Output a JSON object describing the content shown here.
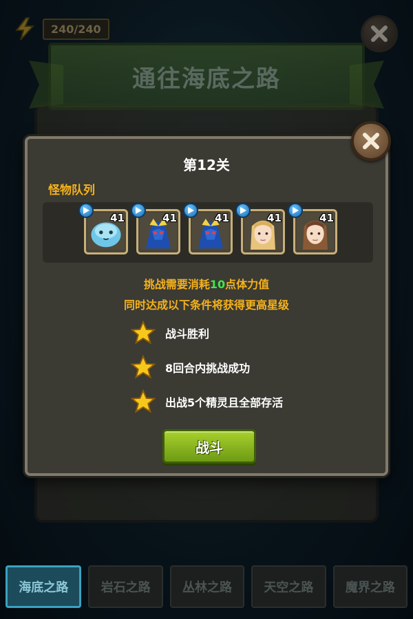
{
  "header": {
    "energy_text": "240/240",
    "banner_title": "通往海底之路"
  },
  "dialog": {
    "title": "第12关",
    "section_label": "怪物队列",
    "monsters": [
      {
        "icon": "blue-slime-icon",
        "level": "41"
      },
      {
        "icon": "blue-dragon-icon",
        "level": "41"
      },
      {
        "icon": "blue-dragon-icon",
        "level": "41"
      },
      {
        "icon": "blonde-girl-icon",
        "level": "41"
      },
      {
        "icon": "brown-hair-girl-icon",
        "level": "41"
      }
    ],
    "cost_prefix": "挑战需要消耗",
    "cost_value": "10",
    "cost_suffix": "点体力值",
    "condition_header": "同时达成以下条件将获得更高星级",
    "conditions": [
      "战斗胜利",
      "8回合内挑战成功",
      "出战5个精灵且全部存活"
    ],
    "fight_label": "战斗"
  },
  "tabs": [
    {
      "label": "海底之路",
      "active": true
    },
    {
      "label": "岩石之路",
      "active": false
    },
    {
      "label": "丛林之路",
      "active": false
    },
    {
      "label": "天空之路",
      "active": false
    },
    {
      "label": "魔界之路",
      "active": false
    }
  ],
  "colors": {
    "accent_orange": "#f5b21c",
    "accent_green": "#3ee84a",
    "button_green": "#8cbb1f"
  }
}
